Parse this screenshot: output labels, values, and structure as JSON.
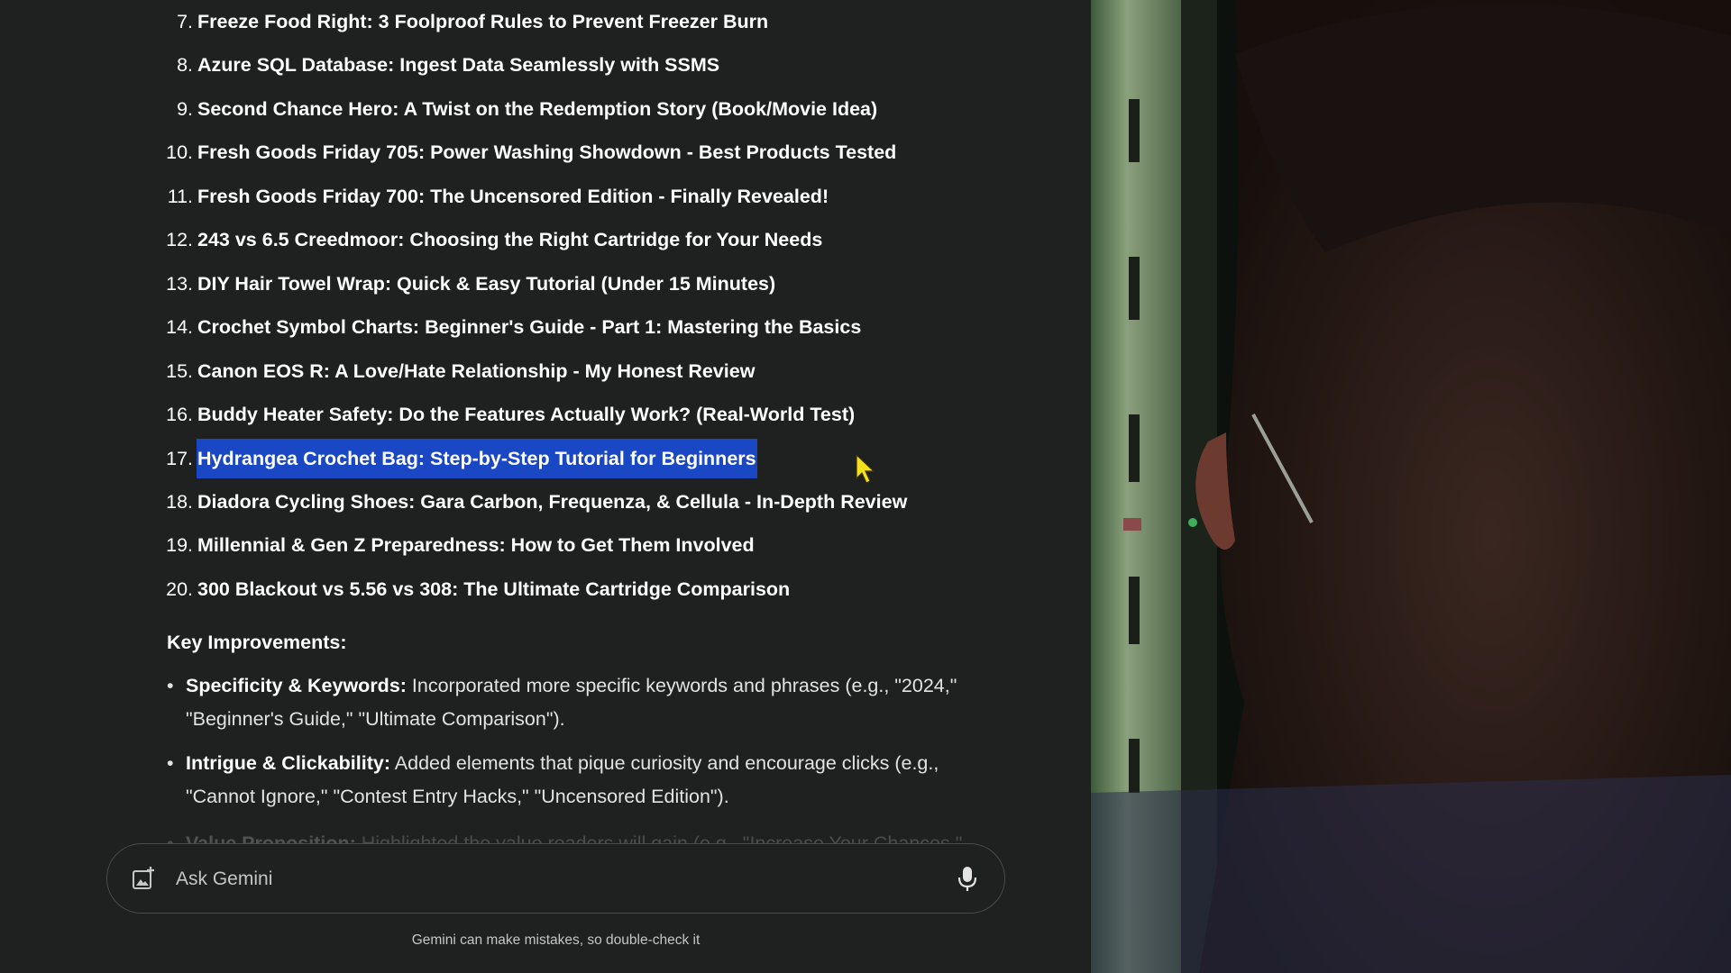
{
  "list_items": [
    {
      "num": "7.",
      "title": "Freeze Food Right: 3 Foolproof Rules to Prevent Freezer Burn"
    },
    {
      "num": "8.",
      "title": "Azure SQL Database: Ingest Data Seamlessly with SSMS"
    },
    {
      "num": "9.",
      "title": "Second Chance Hero: A Twist on the Redemption Story (Book/Movie Idea)"
    },
    {
      "num": "10.",
      "title": "Fresh Goods Friday 705: Power Washing Showdown - Best Products Tested"
    },
    {
      "num": "11.",
      "title": "Fresh Goods Friday 700: The Uncensored Edition - Finally Revealed!"
    },
    {
      "num": "12.",
      "title": "243 vs 6.5 Creedmoor: Choosing the Right Cartridge for Your Needs"
    },
    {
      "num": "13.",
      "title": "DIY Hair Towel Wrap: Quick & Easy Tutorial (Under 15 Minutes)"
    },
    {
      "num": "14.",
      "title": "Crochet Symbol Charts: Beginner's Guide - Part 1: Mastering the Basics"
    },
    {
      "num": "15.",
      "title": "Canon EOS R: A Love/Hate Relationship - My Honest Review"
    },
    {
      "num": "16.",
      "title": "Buddy Heater Safety: Do the Features Actually Work? (Real-World Test)"
    },
    {
      "num": "17.",
      "title": "Hydrangea Crochet Bag: Step-by-Step Tutorial for Beginners"
    },
    {
      "num": "18.",
      "title": "Diadora Cycling Shoes: Gara Carbon, Frequenza, & Cellula - In-Depth Review"
    },
    {
      "num": "19.",
      "title": "Millennial & Gen Z Preparedness: How to Get Them Involved"
    },
    {
      "num": "20.",
      "title": "300 Blackout vs 5.56 vs 308: The Ultimate Cartridge Comparison"
    }
  ],
  "highlighted_item": "17.",
  "key_improvements": {
    "heading": "Key Improvements:",
    "bullets": [
      {
        "label": "Specificity & Keywords:",
        "text": "Incorporated more specific keywords and phrases (e.g., \"2024,\" \"Beginner's Guide,\" \"Ultimate Comparison\")."
      },
      {
        "label": "Intrigue & Clickability:",
        "text": "Added elements that pique curiosity and encourage clicks (e.g., \"Cannot Ignore,\" \"Contest Entry Hacks,\" \"Uncensored Edition\")."
      },
      {
        "label": "Value Proposition:",
        "text": "Highlighted the value readers will gain (e.g., \"Increase Your Chances,\""
      }
    ]
  },
  "input": {
    "placeholder": "Ask Gemini",
    "value": ""
  },
  "disclaimer": "Gemini can make mistakes, so double-check it",
  "icons": {
    "add_image": "add-image-icon",
    "mic": "mic-icon",
    "cursor": "mouse-pointer-icon"
  },
  "colors": {
    "background": "#1f2020",
    "text": "#ffffff",
    "selection": "#1a47c4",
    "cursor": "#f5e11b"
  }
}
